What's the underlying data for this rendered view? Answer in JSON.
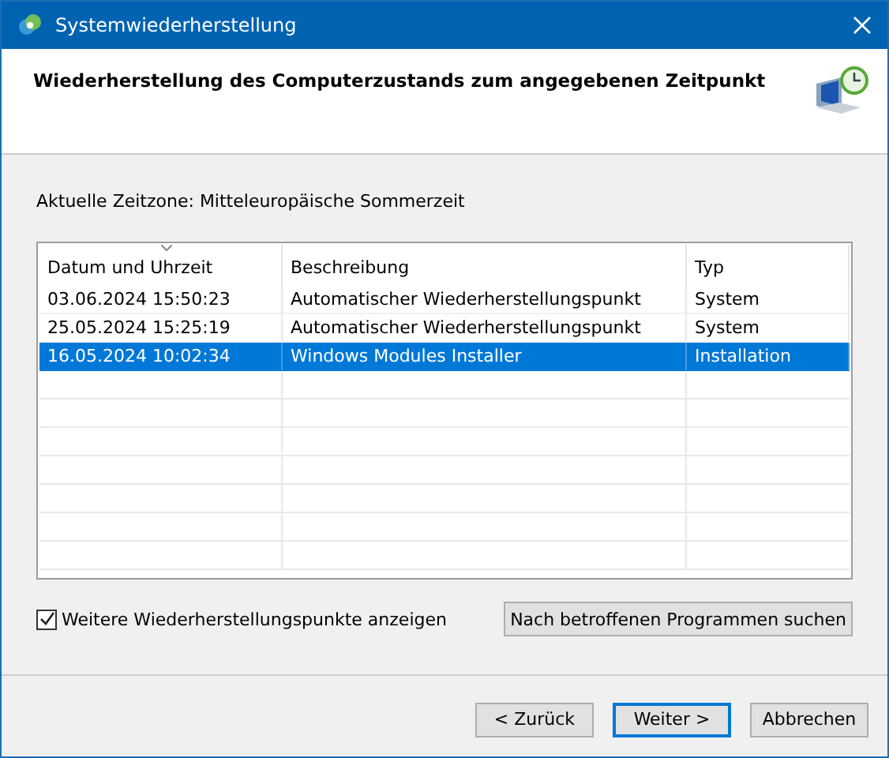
{
  "window": {
    "title": "Systemwiederherstellung"
  },
  "heading": "Wiederherstellung des Computerzustands zum angegebenen Zeitpunkt",
  "timezone": "Aktuelle Zeitzone: Mitteleuropäische Sommerzeit",
  "table": {
    "columns": [
      "Datum und Uhrzeit",
      "Beschreibung",
      "Typ"
    ],
    "rows": [
      {
        "cells": [
          "03.06.2024 15:50:23",
          "Automatischer Wiederherstellungspunkt",
          "System"
        ],
        "selected": false
      },
      {
        "cells": [
          "25.05.2024 15:25:19",
          "Automatischer Wiederherstellungspunkt",
          "System"
        ],
        "selected": false
      },
      {
        "cells": [
          "16.05.2024 10:02:34",
          "Windows Modules Installer",
          "Installation"
        ],
        "selected": true
      }
    ]
  },
  "more_points": {
    "label": "Weitere Wiederherstellungspunkte anzeigen",
    "checked": true
  },
  "scan_button": "Nach betroffenen Programmen suchen",
  "buttons": [
    {
      "label": "< Zurück",
      "default": false
    },
    {
      "label": "Weiter >",
      "default": true
    },
    {
      "label": "Abbrechen",
      "default": false
    }
  ]
}
